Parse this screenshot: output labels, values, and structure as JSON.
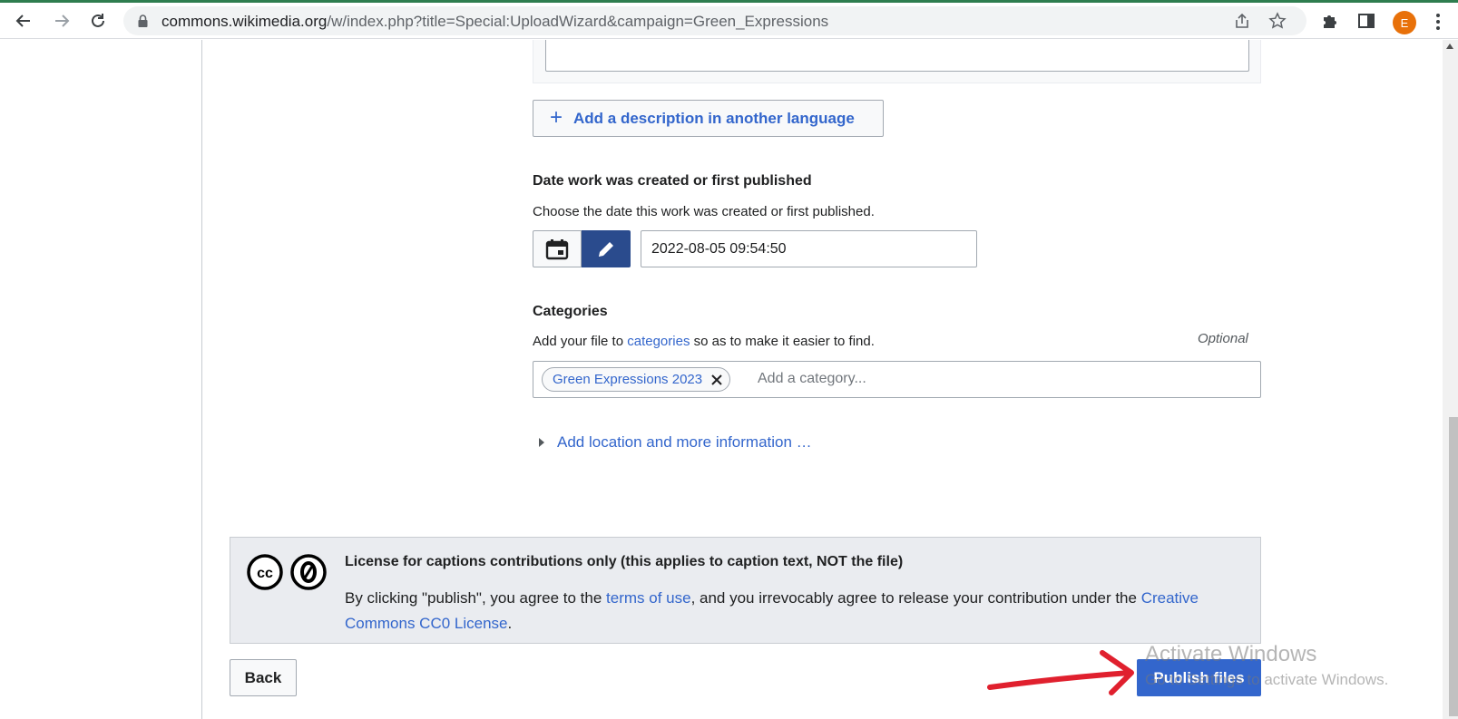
{
  "browser": {
    "url_host": "commons.wikimedia.org",
    "url_path": "/w/index.php?title=Special:UploadWizard&campaign=Green_Expressions",
    "profile_initial": "E",
    "icons": [
      "back-arrow-icon",
      "forward-arrow-icon",
      "reload-icon",
      "lock-icon",
      "share-icon",
      "star-icon",
      "extensions-icon",
      "side-panel-icon",
      "kebab-menu-icon"
    ]
  },
  "form": {
    "add_language_button": "Add a description in another language",
    "date": {
      "label": "Date work was created or first published",
      "help": "Choose the date this work was created or first published.",
      "value": "2022-08-05 09:54:50"
    },
    "categories": {
      "label": "Categories",
      "help_prefix": "Add your file to ",
      "help_link": "categories",
      "help_suffix": " so as to make it easier to find.",
      "optional": "Optional",
      "chips": [
        "Green Expressions 2023"
      ],
      "placeholder": "Add a category..."
    },
    "more_info_link": "Add location and more information …"
  },
  "license": {
    "title": "License for captions contributions only (this applies to caption text, NOT the file)",
    "text_prefix": "By clicking \"publish\", you agree to the ",
    "terms_link": "terms of use",
    "text_middle": ", and you irrevocably agree to release your contribution under the ",
    "cc0_link": "Creative Commons CC0 License",
    "text_suffix": "."
  },
  "actions": {
    "back": "Back",
    "publish": "Publish files"
  },
  "overlay": {
    "watermark_title": "Activate Windows",
    "watermark_sub": "Go to Settings to activate Windows."
  },
  "colors": {
    "link": "#3366cc",
    "primary_button": "#3366cc",
    "edit_toggle": "#2a4b8d",
    "annotation_arrow": "#e0202e"
  }
}
